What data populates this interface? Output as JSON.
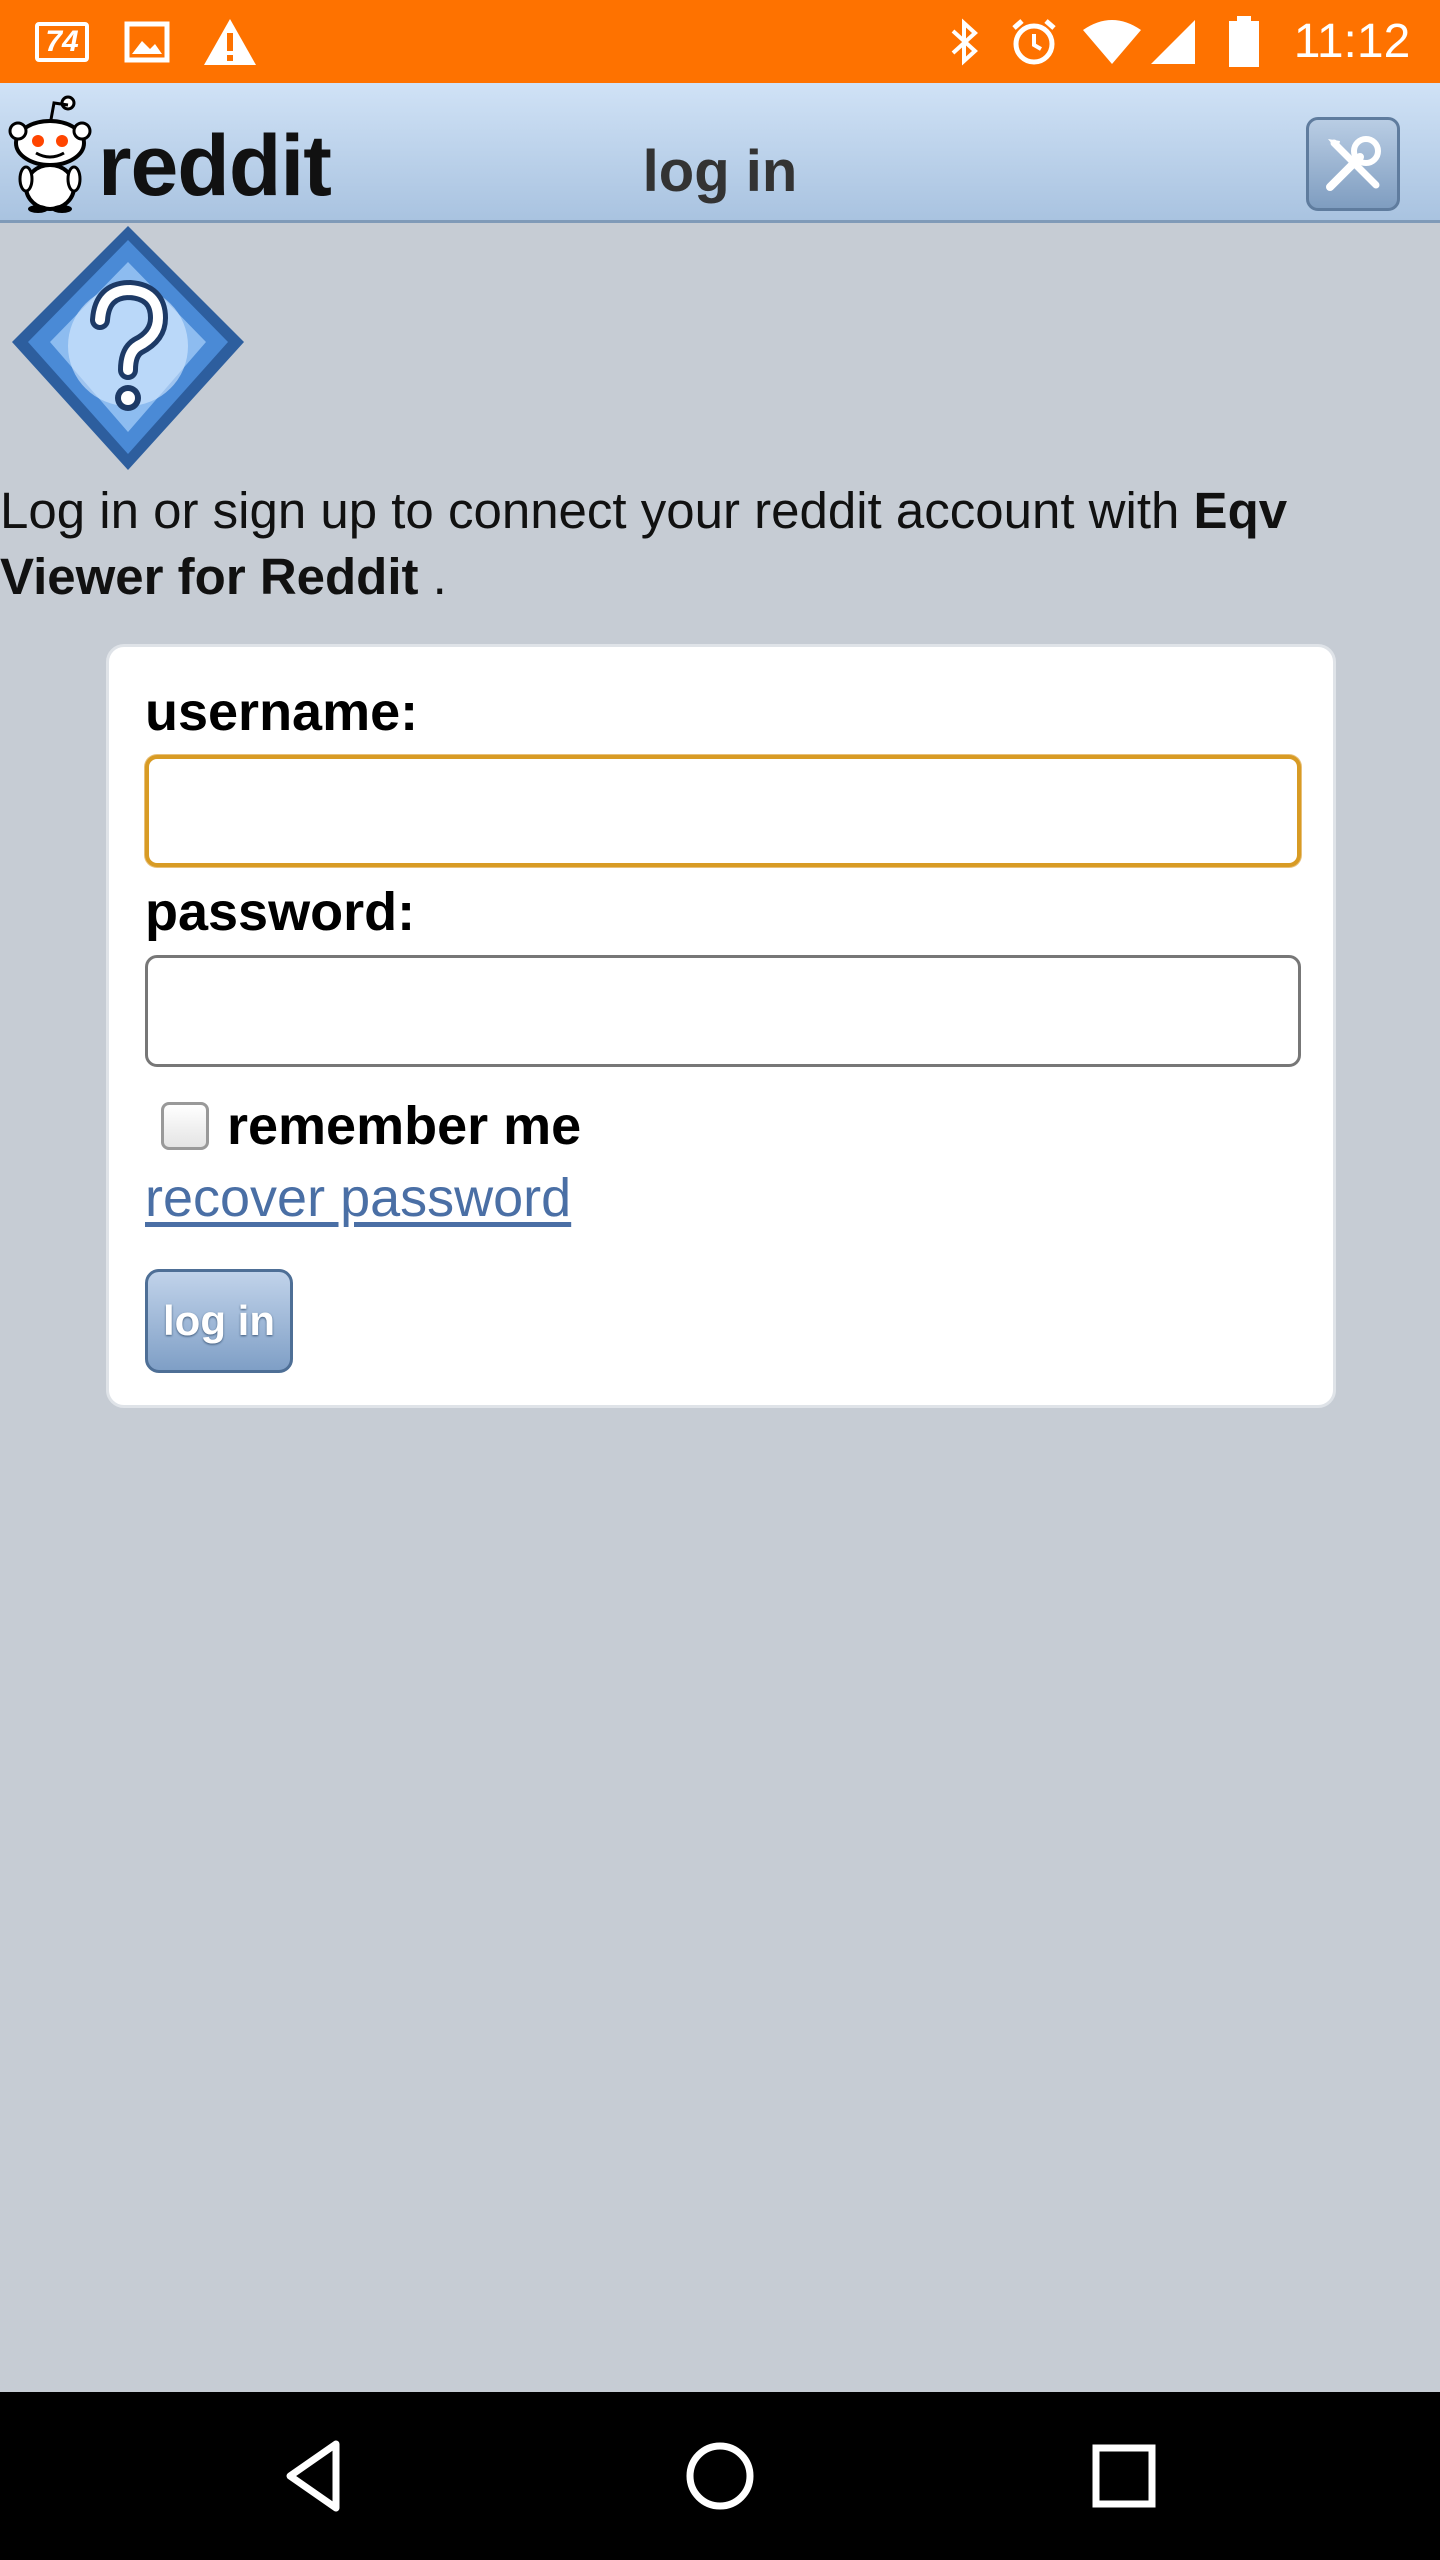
{
  "status_bar": {
    "notification_badge": "74",
    "icons": [
      "image-icon",
      "warning-icon",
      "bluetooth-icon",
      "alarm-icon",
      "wifi-icon",
      "cell-signal-icon",
      "battery-icon"
    ],
    "time": "11:12",
    "color": "#fe7200"
  },
  "header": {
    "logo_text": "reddit",
    "title": "log in",
    "tools_icon": "tools-icon"
  },
  "intro": {
    "text_before": "Log in or sign up to connect your reddit account with ",
    "app_name": "Eqv Viewer for Reddit",
    "text_after": " ."
  },
  "form": {
    "username_label": "username:",
    "username_value": "",
    "password_label": "password:",
    "password_value": "",
    "remember_label": "remember me",
    "remember_checked": false,
    "recover_link": "recover password",
    "submit_label": "log in"
  },
  "nav": {
    "icons": [
      "back-icon",
      "home-icon",
      "recents-icon"
    ]
  }
}
